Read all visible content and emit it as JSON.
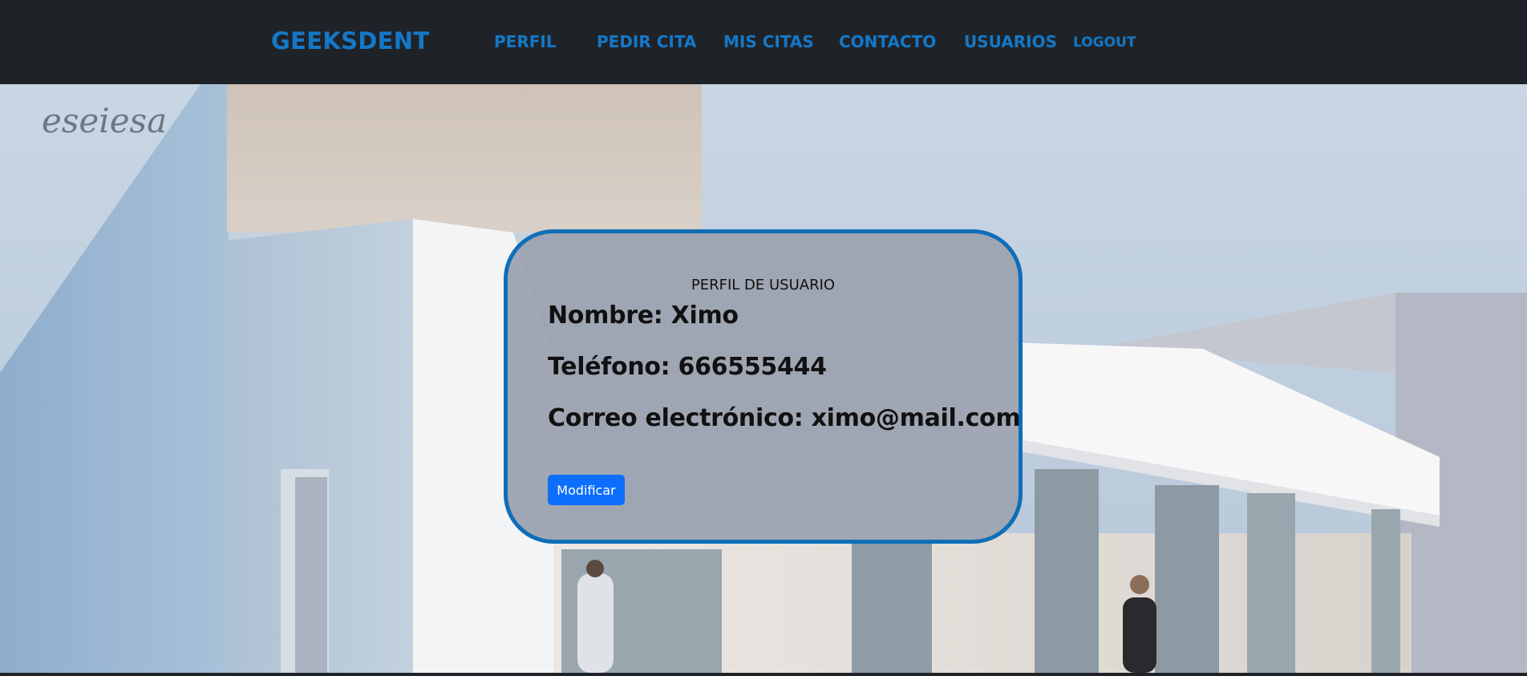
{
  "nav": {
    "brand": "GEEKSDENT",
    "links": [
      "PERFIL",
      "PEDIR CITA",
      "MIS CITAS",
      "CONTACTO",
      "USUARIOS"
    ],
    "logout": "LOGOUT"
  },
  "hero": {
    "signature": "eseiesa"
  },
  "profile": {
    "title": "PERFIL DE USUARIO",
    "name": "Nombre: Ximo",
    "phone": "Teléfono: 666555444",
    "email": "Correo electrónico: ximo@mail.com",
    "modify_label": "Modificar"
  },
  "colors": {
    "navbar": "#1f2328",
    "link": "#1478c8",
    "card_border": "#0f6eb8",
    "card_bg": "#9ea4b2",
    "button": "#0d6efd"
  }
}
